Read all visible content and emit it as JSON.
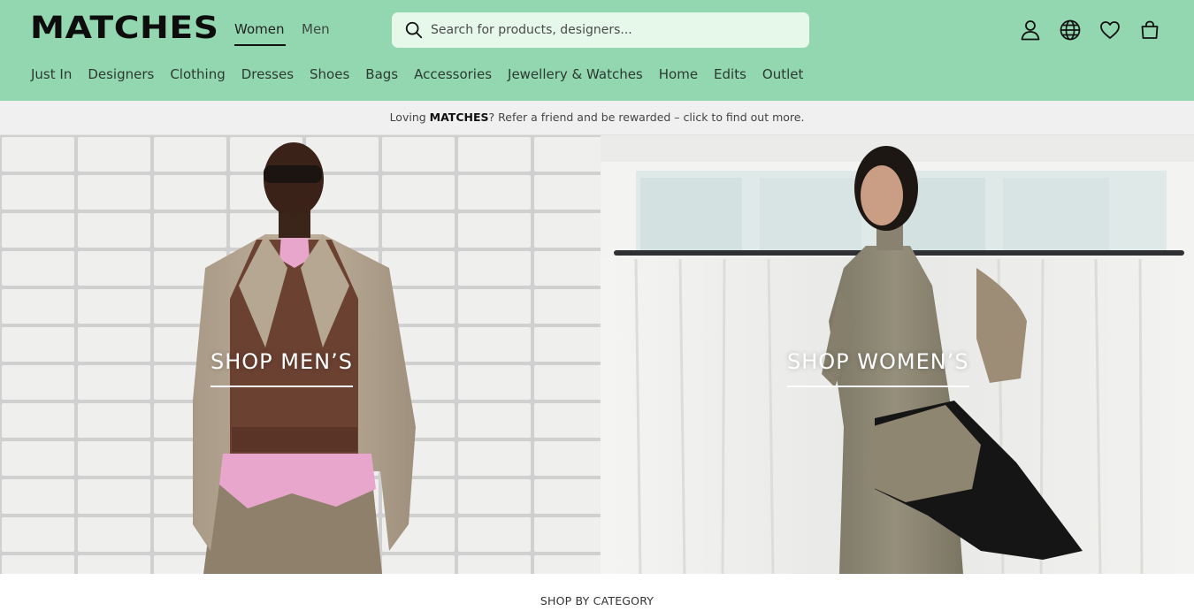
{
  "brand": {
    "logo_text": "MATCHES"
  },
  "gender_tabs": [
    {
      "label": "Women",
      "active": true
    },
    {
      "label": "Men",
      "active": false
    }
  ],
  "search": {
    "placeholder": "Search for products, designers..."
  },
  "header_icons": [
    "account-icon",
    "globe-icon",
    "heart-icon",
    "bag-icon"
  ],
  "nav": {
    "items": [
      {
        "label": "Just In"
      },
      {
        "label": "Designers"
      },
      {
        "label": "Clothing"
      },
      {
        "label": "Dresses"
      },
      {
        "label": "Shoes"
      },
      {
        "label": "Bags"
      },
      {
        "label": "Accessories"
      },
      {
        "label": "Jewellery & Watches"
      },
      {
        "label": "Home"
      },
      {
        "label": "Edits"
      },
      {
        "label": "Outlet"
      }
    ]
  },
  "promo": {
    "prefix": "Loving ",
    "brand": "MATCHES",
    "suffix": "? Refer a friend and be rewarded – click to find out more."
  },
  "hero": {
    "men": {
      "cta": "SHOP MEN’S"
    },
    "women": {
      "cta": "SHOP WOMEN’S"
    }
  },
  "section": {
    "title": "SHOP BY CATEGORY"
  },
  "colors": {
    "header_bg": "#93d7b0",
    "search_bg": "#e6f8ea",
    "promo_bg": "#f0f0f0"
  }
}
